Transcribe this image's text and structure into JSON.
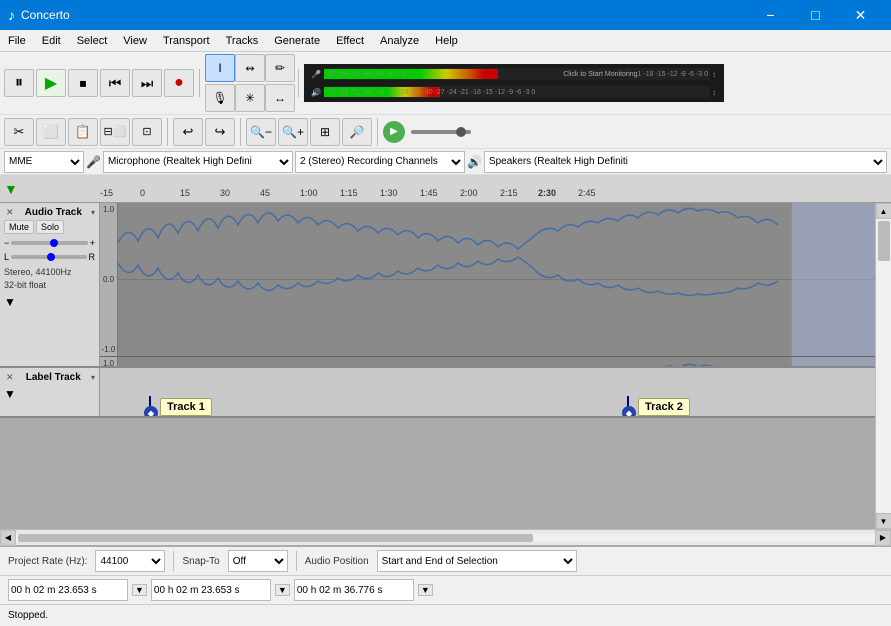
{
  "app": {
    "title": "Concerto",
    "icon": "♪"
  },
  "titlebar": {
    "title": "Concerto",
    "minimize": "−",
    "maximize": "□",
    "close": "✕"
  },
  "menubar": {
    "items": [
      "File",
      "Edit",
      "Select",
      "View",
      "Transport",
      "Tracks",
      "Generate",
      "Effect",
      "Analyze",
      "Help"
    ]
  },
  "toolbar": {
    "transport": {
      "pause": "⏸",
      "play": "▶",
      "stop": "⏹",
      "prev": "⏮",
      "next": "⏭",
      "record": "●"
    },
    "tools": [
      "I",
      "↔",
      "✎",
      "🎤",
      "↕",
      "←"
    ],
    "zoom": [
      "🔍−",
      "🔍+",
      "🔍↔",
      "🔍"
    ],
    "edit": [
      "✂",
      "⬜",
      "⬜",
      "⊞",
      "⊟"
    ]
  },
  "devices": {
    "host": "MME",
    "microphone_label": "Microphone (Realtek High Defini",
    "channels": "2 (Stereo) Recording Channels",
    "speakers_label": "Speakers (Realtek High Definiti"
  },
  "ruler": {
    "marks": [
      "-15",
      "0",
      "15",
      "30",
      "45",
      "1:00",
      "1:15",
      "1:30",
      "1:45",
      "2:00",
      "2:15",
      "2:30",
      "2:45"
    ],
    "arrow": "▼"
  },
  "audio_track": {
    "name": "Audio Track",
    "close_btn": "✕",
    "dropdown": "▾",
    "mute_label": "Mute",
    "solo_label": "Solo",
    "info": "Stereo, 44100Hz\n32-bit float",
    "scale_top": "1.0",
    "scale_mid": "0.0",
    "scale_bot": "-1.0",
    "down_arrow": "▼"
  },
  "label_track": {
    "name": "Label Track",
    "close_btn": "✕",
    "dropdown": "▾",
    "down_arrow": "▼",
    "label1": "Track 1",
    "label2": "Track 2"
  },
  "footer": {
    "project_rate_label": "Project Rate (Hz):",
    "project_rate_value": "44100",
    "snap_to_label": "Snap-To",
    "snap_to_value": "Off",
    "audio_position_label": "Audio Position",
    "selection_label": "Start and End of Selection",
    "pos_value": "00 h 02 m 23.653 s",
    "start_value": "00 h 02 m 23.653 s",
    "end_value": "00 h 02 m 36.776 s"
  },
  "status": {
    "text": "Stopped."
  },
  "scrollbar": {
    "left": "◀",
    "right": "▶",
    "up": "▲",
    "down": "▼"
  }
}
